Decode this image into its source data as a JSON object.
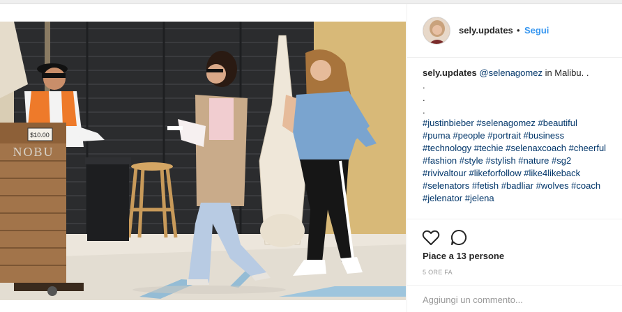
{
  "post": {
    "username": "sely.updates",
    "separator": "•",
    "follow_label": "Segui",
    "caption": {
      "user": "sely.updates",
      "mention": "@selenagomez",
      "text": " in Malibu. .",
      "dots": [
        ".",
        ".",
        "."
      ],
      "hashtag_lines": [
        "#justinbieber #selenagomez #beautiful",
        "#puma #people #portrait #business",
        "#technology #techie #selenaxcoach #cheerful",
        "#fashion #style #stylish #nature #sg2",
        "#rivivaltour #likeforfollow #like4likeback",
        "#selenators #fetish #badliar #wolves #coach",
        "#jelenator #jelena"
      ]
    },
    "likes_prefix": "Piace a ",
    "likes_count": "13 persone",
    "timestamp": "5 ORE FA",
    "comment_placeholder": "Aggiungi un commento...",
    "photo_texts": {
      "sign_price": "$10.00",
      "sign_name": "NOBU"
    }
  },
  "icons": {
    "like": "heart-icon",
    "comment": "speech-bubble-icon"
  },
  "colors": {
    "link": "#3897f0",
    "text": "#262626",
    "muted": "#999999",
    "hashtag": "#003569"
  }
}
